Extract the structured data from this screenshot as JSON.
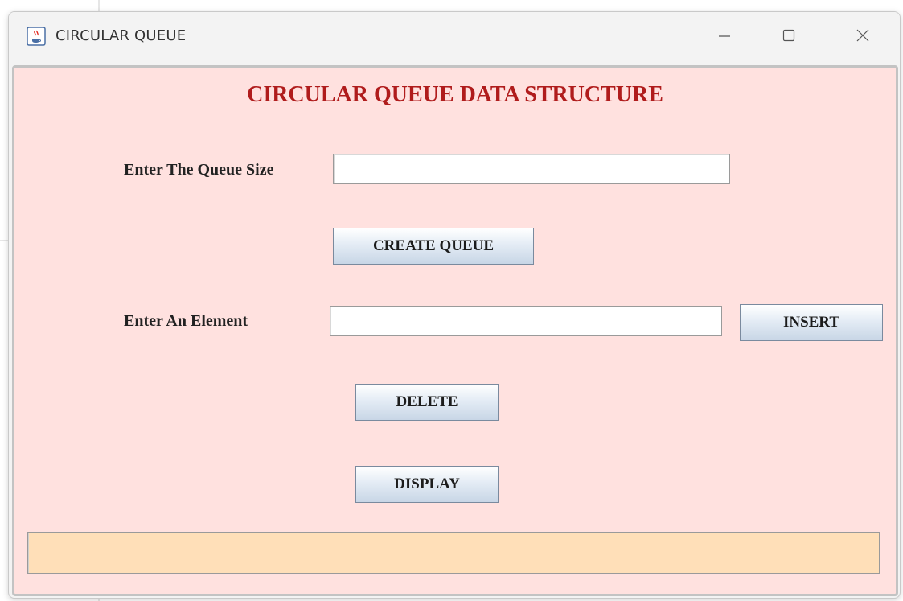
{
  "window": {
    "title": "CIRCULAR QUEUE"
  },
  "title_icons": {
    "app": "java-cup-icon",
    "minimize": "minimize-icon",
    "maximize": "maximize-icon",
    "close": "close-icon"
  },
  "form": {
    "heading": "CIRCULAR QUEUE DATA STRUCTURE",
    "queue_size_label": "Enter The Queue Size",
    "queue_size_value": "",
    "create_button": "CREATE QUEUE",
    "element_label": "Enter An Element",
    "element_value": "",
    "insert_button": "INSERT",
    "delete_button": "DELETE",
    "display_button": "DISPLAY",
    "status_text": ""
  },
  "colors": {
    "content_bg": "#ffe1df",
    "heading": "#b01c1c",
    "status_bg": "#ffdfb8"
  }
}
